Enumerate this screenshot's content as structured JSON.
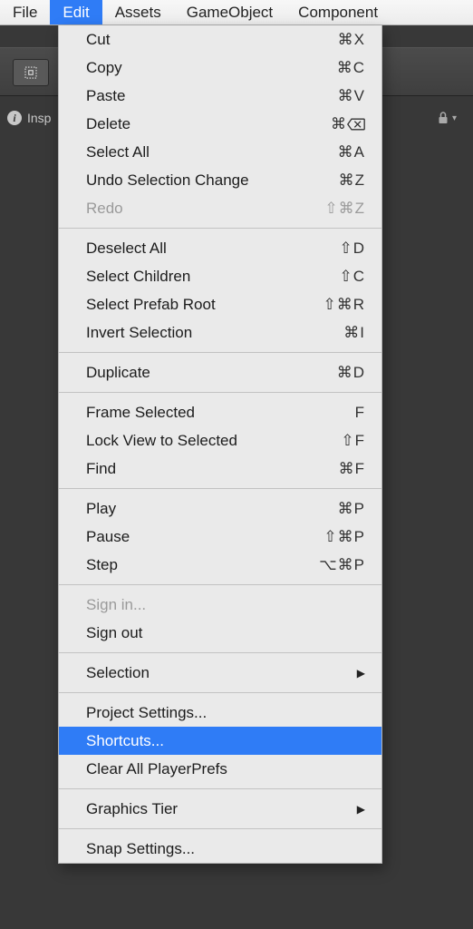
{
  "menubar": {
    "items": [
      {
        "label": "File"
      },
      {
        "label": "Edit"
      },
      {
        "label": "Assets"
      },
      {
        "label": "GameObject"
      },
      {
        "label": "Component"
      }
    ]
  },
  "inspector": {
    "label": "Insp"
  },
  "edit_menu": {
    "groups": [
      [
        {
          "label": "Cut",
          "shortcut": "⌘X"
        },
        {
          "label": "Copy",
          "shortcut": "⌘C"
        },
        {
          "label": "Paste",
          "shortcut": "⌘V"
        },
        {
          "label": "Delete",
          "shortcut": "⌘",
          "del_glyph": true
        },
        {
          "label": "Select All",
          "shortcut": "⌘A"
        },
        {
          "label": "Undo Selection Change",
          "shortcut": "⌘Z"
        },
        {
          "label": "Redo",
          "shortcut": "⇧⌘Z",
          "disabled": true
        }
      ],
      [
        {
          "label": "Deselect All",
          "shortcut": "⇧D"
        },
        {
          "label": "Select Children",
          "shortcut": "⇧C"
        },
        {
          "label": "Select Prefab Root",
          "shortcut": "⇧⌘R"
        },
        {
          "label": "Invert Selection",
          "shortcut": "⌘I"
        }
      ],
      [
        {
          "label": "Duplicate",
          "shortcut": "⌘D"
        }
      ],
      [
        {
          "label": "Frame Selected",
          "shortcut": "F"
        },
        {
          "label": "Lock View to Selected",
          "shortcut": "⇧F"
        },
        {
          "label": "Find",
          "shortcut": "⌘F"
        }
      ],
      [
        {
          "label": "Play",
          "shortcut": "⌘P"
        },
        {
          "label": "Pause",
          "shortcut": "⇧⌘P"
        },
        {
          "label": "Step",
          "shortcut": "⌥⌘P"
        }
      ],
      [
        {
          "label": "Sign in...",
          "disabled": true
        },
        {
          "label": "Sign out"
        }
      ],
      [
        {
          "label": "Selection",
          "submenu": true
        }
      ],
      [
        {
          "label": "Project Settings..."
        },
        {
          "label": "Shortcuts...",
          "highlight": true
        },
        {
          "label": "Clear All PlayerPrefs"
        }
      ],
      [
        {
          "label": "Graphics Tier",
          "submenu": true
        }
      ],
      [
        {
          "label": "Snap Settings..."
        }
      ]
    ]
  }
}
